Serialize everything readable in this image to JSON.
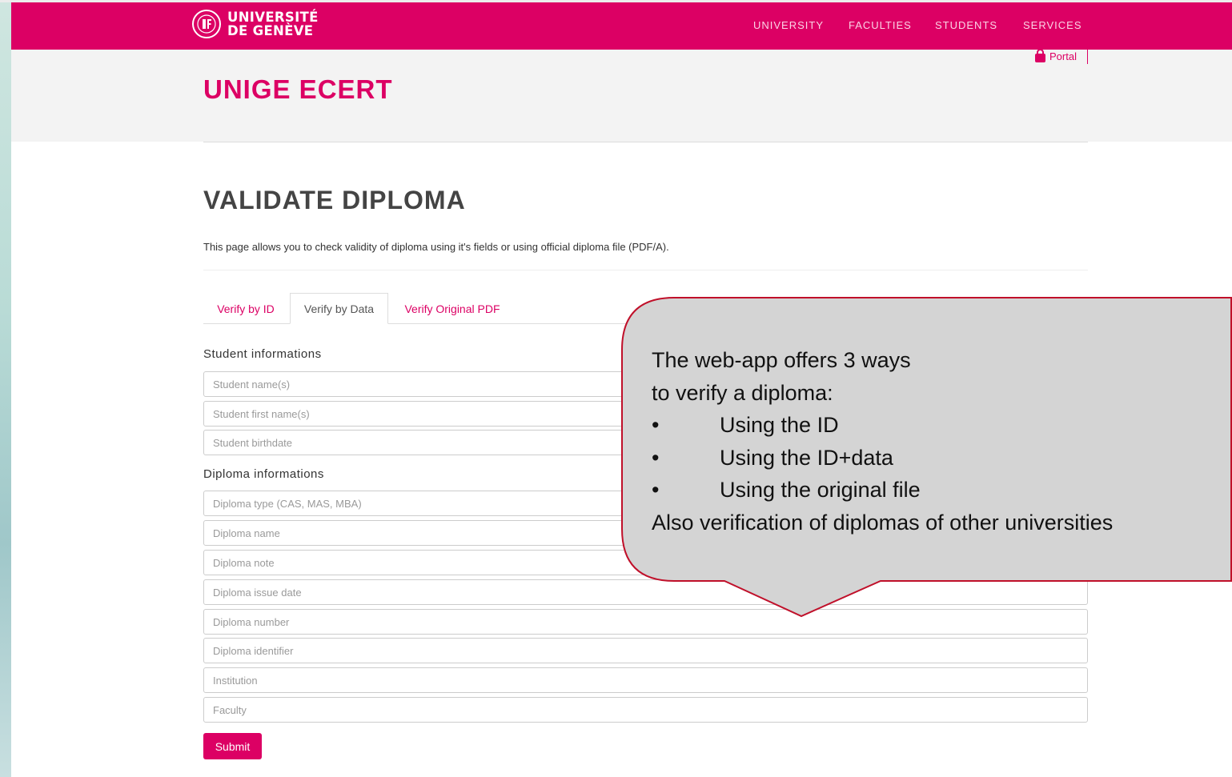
{
  "header": {
    "logo_line1": "UNIVERSITÉ",
    "logo_line2": "DE GENÈVE",
    "nav": [
      "UNIVERSITY",
      "FACULTIES",
      "STUDENTS",
      "SERVICES"
    ],
    "portal_label": "Portal"
  },
  "site_title": "UNIGE ECERT",
  "page": {
    "heading": "VALIDATE DIPLOMA",
    "intro": "This page allows you to check validity of diploma using it's fields or using official diploma file (PDF/A)."
  },
  "tabs": [
    {
      "label": "Verify by ID",
      "active": false
    },
    {
      "label": "Verify by Data",
      "active": true
    },
    {
      "label": "Verify Original PDF",
      "active": false
    }
  ],
  "form": {
    "student_section": "Student informations",
    "student_fields": [
      {
        "placeholder": "Student name(s)",
        "value": ""
      },
      {
        "placeholder": "Student first name(s)",
        "value": ""
      },
      {
        "placeholder": "Student birthdate",
        "value": ""
      }
    ],
    "diploma_section": "Diploma informations",
    "diploma_fields": [
      {
        "placeholder": "Diploma type (CAS, MAS, MBA)",
        "value": ""
      },
      {
        "placeholder": "Diploma name",
        "value": ""
      },
      {
        "placeholder": "Diploma note",
        "value": ""
      },
      {
        "placeholder": "Diploma issue date",
        "value": ""
      },
      {
        "placeholder": "Diploma number",
        "value": ""
      },
      {
        "placeholder": "Diploma identifier",
        "value": ""
      },
      {
        "placeholder": "Institution",
        "value": ""
      },
      {
        "placeholder": "Faculty",
        "value": ""
      }
    ],
    "submit_label": "Submit"
  },
  "callout": {
    "line1": "The web-app offers 3 ways",
    "line2": "to verify a diploma:",
    "bullets": [
      "Using the ID",
      "Using the ID+data",
      "Using the original file"
    ],
    "line_last": "Also verification of diplomas of other universities"
  },
  "colors": {
    "brand": "#dc0064",
    "callout_fill": "#d4d4d4",
    "callout_border": "#c0102a"
  }
}
